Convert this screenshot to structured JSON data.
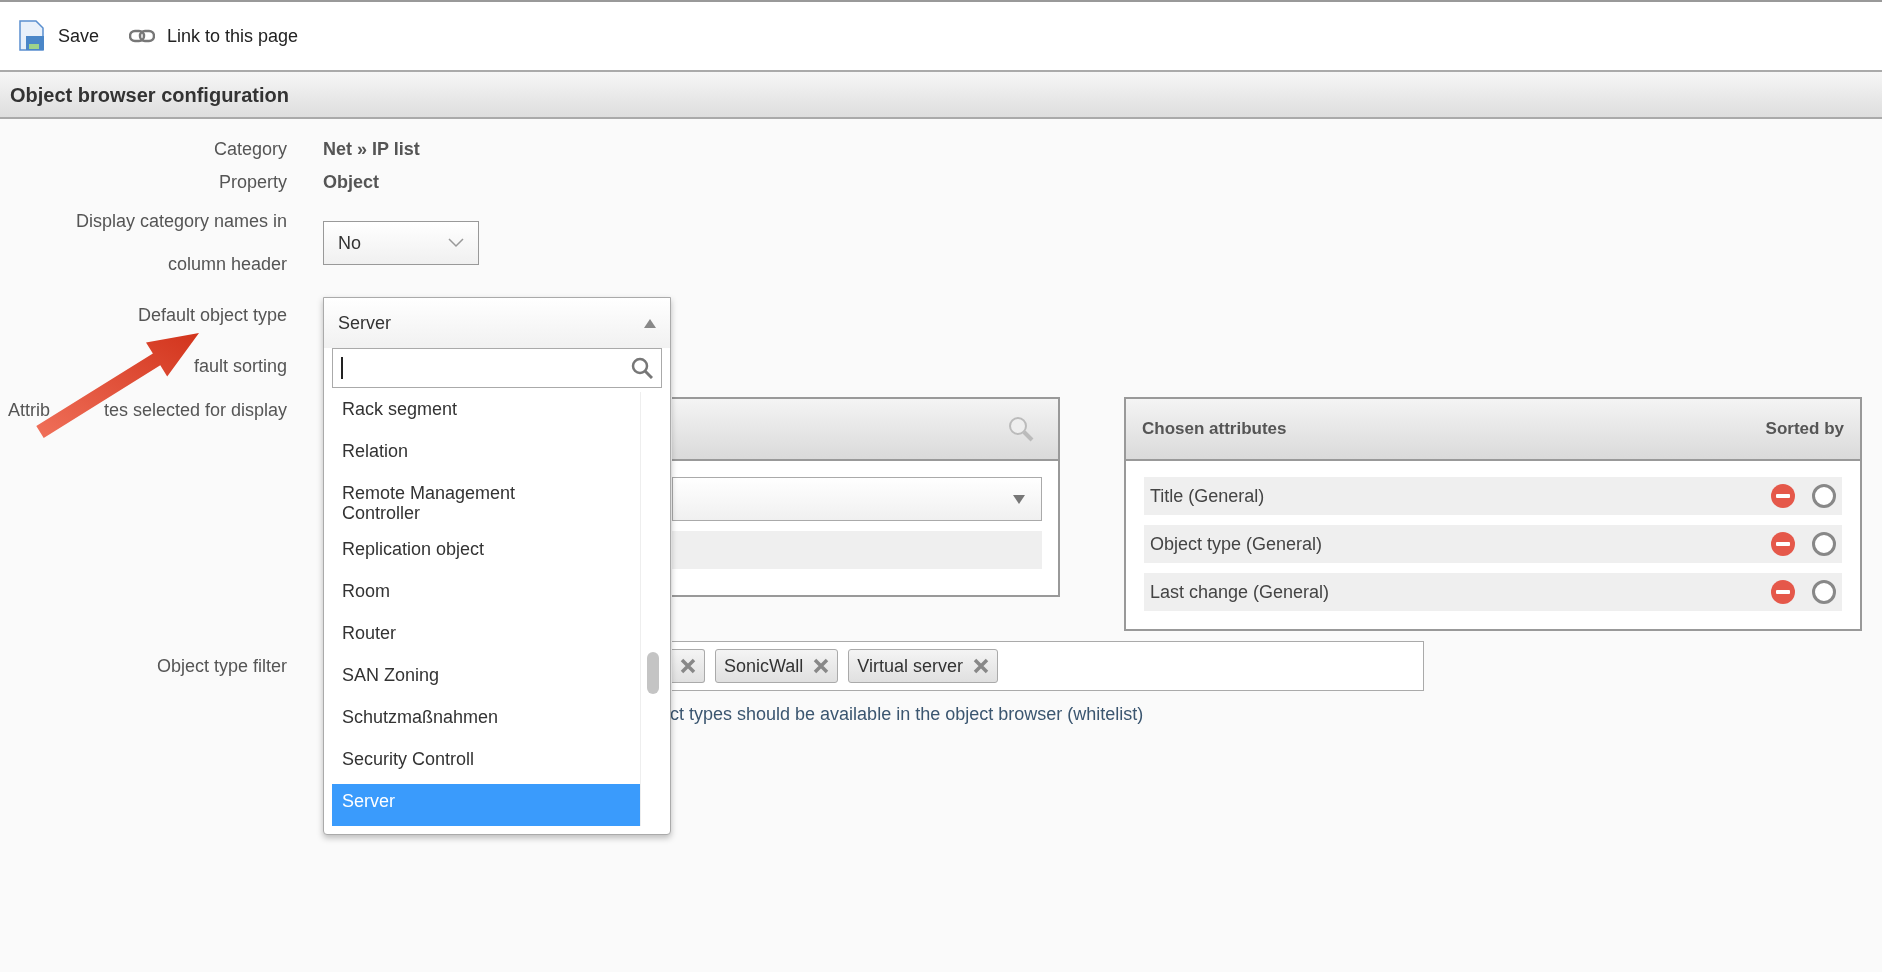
{
  "toolbar": [
    {
      "label": "Save"
    },
    {
      "label": "Link to this page"
    }
  ],
  "section_title": "Object browser configuration",
  "form": {
    "category": {
      "label": "Category",
      "value": "Net » IP list"
    },
    "property": {
      "label": "Property",
      "value": "Object"
    },
    "display_category_names": {
      "label_lines": [
        "Display category names in",
        "column header"
      ],
      "value": "No"
    },
    "default_object_type": {
      "label": "Default object type",
      "value": "Server",
      "expanded": true
    },
    "default_sorting": {
      "label": "fault sorting"
    },
    "attributes": {
      "label_parts": [
        "Attrib",
        "tes selected for display"
      ],
      "chosen": {
        "title": "Chosen attributes",
        "sorted_by_title": "Sorted by",
        "items": [
          {
            "label": "Title (General)",
            "sorted": false
          },
          {
            "label": "Object type (General)",
            "sorted": false
          },
          {
            "label": "Last change (General)",
            "sorted": false
          }
        ]
      }
    },
    "object_type_filter": {
      "label": "Object type filter",
      "chips": [
        {
          "kind": "cut"
        },
        {
          "kind": "full",
          "label": "SonicWall"
        },
        {
          "kind": "full",
          "label": "Virtual server"
        }
      ],
      "help": "ct types should be available in the object browser (whitelist)"
    }
  },
  "dropdown": {
    "options": [
      {
        "label": "Rack segment",
        "selected": false
      },
      {
        "label": "Relation",
        "selected": false
      },
      {
        "label": "Remote Management Controller",
        "selected": false
      },
      {
        "label": "Replication object",
        "selected": false
      },
      {
        "label": "Room",
        "selected": false
      },
      {
        "label": "Router",
        "selected": false
      },
      {
        "label": "SAN Zoning",
        "selected": false
      },
      {
        "label": "Schutzmaßnahmen",
        "selected": false
      },
      {
        "label": "Security Controll",
        "selected": false
      },
      {
        "label": "Server",
        "selected": true
      }
    ]
  }
}
